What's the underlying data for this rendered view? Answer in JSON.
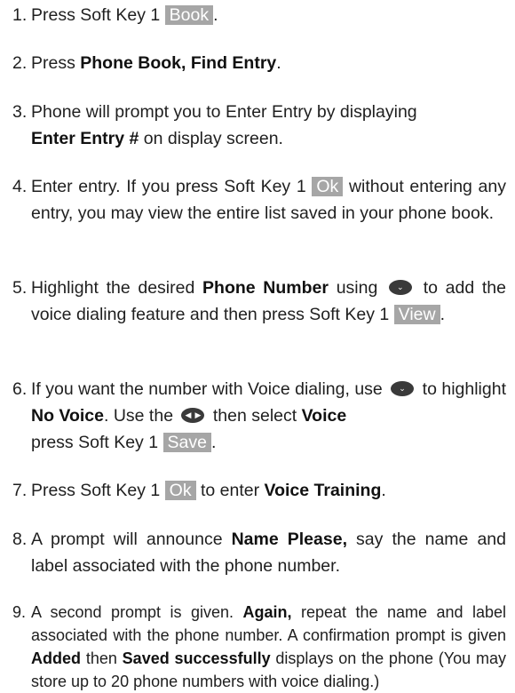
{
  "steps": [
    {
      "num": "1.",
      "pre": "Press Soft Key 1 ",
      "softkey": "Book",
      "post": "."
    },
    {
      "num": "2.",
      "pre": "Press ",
      "bold": "Phone Book, Find Entry",
      "post": "."
    },
    {
      "num": "3.",
      "line1": "Phone will prompt you to Enter Entry by displaying",
      "bold": "Enter Entry #",
      "post": " on display screen."
    },
    {
      "num": "4.",
      "pre": "Enter entry. If you press Soft Key 1 ",
      "softkey": "Ok",
      "post": " without entering any entry, you may view the entire list saved in your phone book."
    },
    {
      "num": "5.",
      "pre": "Highlight the desired ",
      "bold": "Phone Number",
      "mid": " using ",
      "icon": "nav-down-icon",
      "post": " to add the voice dialing feature and then press Soft Key 1 ",
      "softkey": "View",
      "end": "."
    },
    {
      "num": "6.",
      "pre": "If you want the number with Voice dialing, use ",
      "icon1": "nav-down-icon",
      "mid1": " to highlight ",
      "bold1": "No Voice",
      "mid2": ". Use the ",
      "icon2": "nav-left-right-icon",
      "mid3": " then select ",
      "bold2": "Voice",
      "mid4": " press  Soft Key 1 ",
      "softkey": "Save",
      "end": "."
    },
    {
      "num": "7.",
      "pre": "Press Soft Key 1 ",
      "softkey": "Ok",
      "mid": " to enter ",
      "bold": "Voice Training",
      "post": "."
    },
    {
      "num": "8.",
      "pre": "A prompt will announce ",
      "bold": "Name Please,",
      "post": " say the name and label associated with the phone number."
    },
    {
      "num": "9.",
      "pre": "A second prompt is given. ",
      "bold1": "Again,",
      "mid1": " repeat the name and label associated with the phone number. A confirmation prompt is given ",
      "bold2": "Added",
      "mid2": " then ",
      "bold3": "Saved successfully",
      "post": " displays on the phone (You may store up to 20 phone numbers with voice dialing.)"
    }
  ]
}
